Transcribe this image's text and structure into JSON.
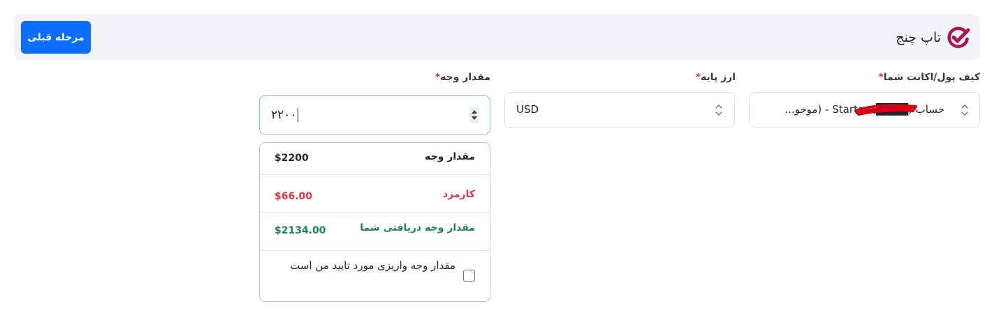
{
  "header": {
    "brand_name": "تاپ چنج",
    "prev_button_label": "مرحله قبلی",
    "brand_color": "#b0124f",
    "button_color": "#0d6efd"
  },
  "fields": {
    "wallet": {
      "label": "کیف پول/اکانت شما",
      "required_mark": "*",
      "value": "حساب (████) Starter - (موجو..."
    },
    "base_currency": {
      "label": "ارز پایه",
      "required_mark": "*",
      "value": "USD"
    },
    "amount": {
      "label": "مقدار وجه",
      "required_mark": "*",
      "value": "۲۲۰۰"
    }
  },
  "summary": {
    "amount_label": "مقدار وجه",
    "amount_value": "$2200",
    "fee_label": "کارمزد",
    "fee_value": "$66.00",
    "received_label": "مقدار وجه دریافتی شما",
    "received_value": "$2134.00",
    "confirm_text": "مقدار وجه واریزی مورد تایید من است",
    "confirm_checked": false
  },
  "colors": {
    "required": "#dc3545",
    "fee": "#dc3545",
    "received": "#198754",
    "focus_border": "#86b7fe"
  }
}
